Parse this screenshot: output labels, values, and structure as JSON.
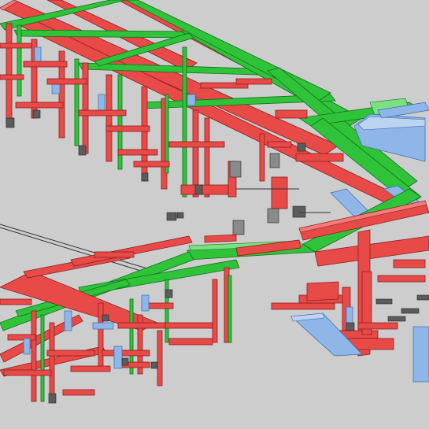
{
  "scene": {
    "kind": "3D isometric MEP coordination model",
    "systems": [
      {
        "id": "supply-duct",
        "color": "#e84a48"
      },
      {
        "id": "return-duct",
        "color": "#2fc33a"
      },
      {
        "id": "piping",
        "color": "#8fb6e8"
      },
      {
        "id": "equipment",
        "color": "#5c5c5c"
      }
    ],
    "background_color": "#cdcdcd"
  }
}
